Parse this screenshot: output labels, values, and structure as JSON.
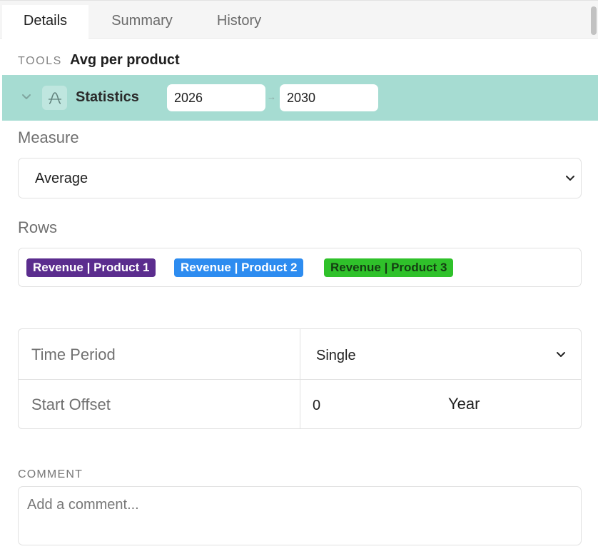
{
  "tabs": [
    {
      "label": "Details",
      "active": true
    },
    {
      "label": "Summary",
      "active": false
    },
    {
      "label": "History",
      "active": false
    }
  ],
  "tools": {
    "label": "TOOLS",
    "title": "Avg per product"
  },
  "statistics": {
    "title": "Statistics",
    "icon": "distribution-curve-icon",
    "year_from": "2026",
    "year_to": "2030",
    "bar_color": "#a6dcd2"
  },
  "measure": {
    "label": "Measure",
    "value": "Average"
  },
  "rows": {
    "label": "Rows",
    "tags": [
      {
        "label": "Revenue | Product 1",
        "bg": "#5b2d8e",
        "fg": "#ffffff"
      },
      {
        "label": "Revenue | Product 2",
        "bg": "#2d8cf0",
        "fg": "#ffffff"
      },
      {
        "label": "Revenue | Product 3",
        "bg": "#2fc12a",
        "fg": "#153d13"
      }
    ]
  },
  "settings": {
    "time_period_label": "Time Period",
    "time_period_value": "Single",
    "start_offset_label": "Start Offset",
    "start_offset_value": "0",
    "start_offset_unit": "Year"
  },
  "comment": {
    "label": "COMMENT",
    "placeholder": "Add a comment..."
  }
}
